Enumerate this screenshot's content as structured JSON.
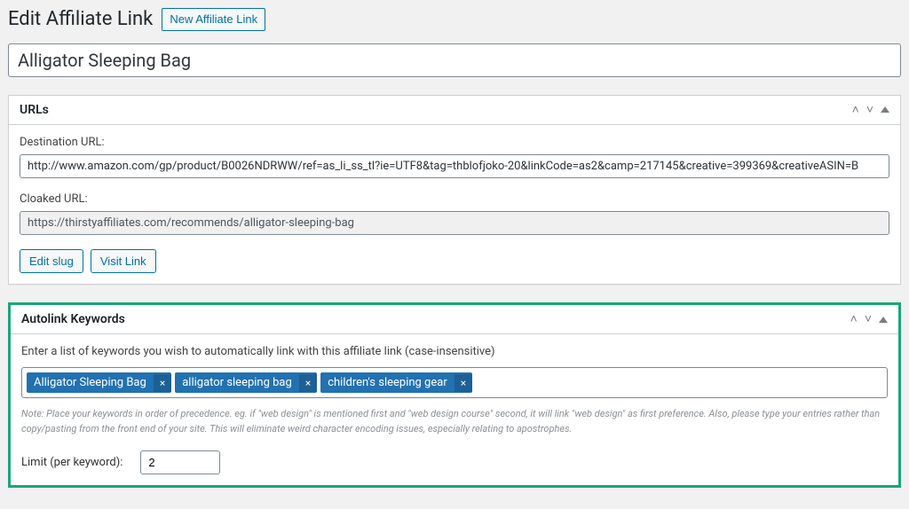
{
  "header": {
    "title": "Edit Affiliate Link",
    "new_button": "New Affiliate Link"
  },
  "title_field": {
    "value": "Alligator Sleeping Bag"
  },
  "urls_box": {
    "heading": "URLs",
    "destination_label": "Destination URL:",
    "destination_value": "http://www.amazon.com/gp/product/B0026NDRWW/ref=as_li_ss_tl?ie=UTF8&tag=thblofjoko-20&linkCode=as2&camp=217145&creative=399369&creativeASIN=B",
    "cloaked_label": "Cloaked URL:",
    "cloaked_value": "https://thirstyaffiliates.com/recommends/alligator-sleeping-bag",
    "edit_slug": "Edit slug",
    "visit_link": "Visit Link"
  },
  "autolink_box": {
    "heading": "Autolink Keywords",
    "instruction": "Enter a list of keywords you wish to automatically link with this affiliate link (case-insensitive)",
    "tags": [
      "Alligator Sleeping Bag",
      "alligator sleeping bag",
      "children's sleeping gear"
    ],
    "note": "Note: Place your keywords in order of precedence. eg. if \"web design\" is mentioned first and \"web design course\" second, it will link \"web design\" as first preference. Also, please type your entries rather than copy/pasting from the front end of your site. This will eliminate weird character encoding issues, especially relating to apostrophes.",
    "limit_label": "Limit (per keyword):",
    "limit_value": "2"
  }
}
